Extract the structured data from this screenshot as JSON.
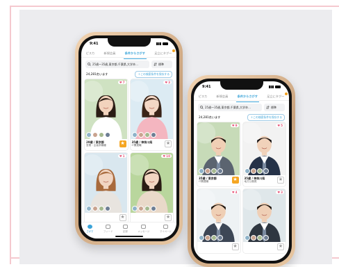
{
  "colors": {
    "accent": "#3aa3d8",
    "like": "#e8567a",
    "fav_on": "#f5a623",
    "panel_bg": "#ececef",
    "border": "#f5c9cf"
  },
  "phone_left": {
    "status": {
      "time": "9:41"
    },
    "tabs": [
      {
        "label": "ピスカ"
      },
      {
        "label": "新規会員"
      },
      {
        "label": "条件からさがす"
      },
      {
        "label": "足立にタグ〜"
      }
    ],
    "search": {
      "query": "25歳〜35歳,東京都,千葉県,大学卒…",
      "sort": "標準",
      "icon": "search-icon"
    },
    "count_text": "24,281名います",
    "add_condition_label": "＋この検索条件を保存する",
    "cards": [
      {
        "likes": "7",
        "age_place": "29歳 / 東京都",
        "job": "営業・企画系職種",
        "fav": true,
        "photo": "woman-blue-dress",
        "bg": "#cfe2c2",
        "skin": "#f2d3bd",
        "hair": "#2a1c14",
        "shirt": "#ffffff"
      },
      {
        "likes": "3",
        "age_place": "35歳 / 神奈川県",
        "job": "IT関連職",
        "fav": false,
        "photo": "woman-pink-top",
        "bg": "#dcebf3",
        "skin": "#f4d8c6",
        "hair": "#3a2418",
        "shirt": "#f4b6c0"
      },
      {
        "likes": "1",
        "age_place": "",
        "job": "",
        "fav": false,
        "photo": "woman-orange-hair",
        "bg": "#d9e7ef",
        "skin": "#f1d5c2",
        "hair": "#a86a3c",
        "shirt": "#e8e4df"
      },
      {
        "likes": "10",
        "age_place": "",
        "job": "",
        "fav": false,
        "photo": "woman-green-park",
        "bg": "#b9d69d",
        "skin": "#f2d5c1",
        "hair": "#2a1c14",
        "shirt": "#e9d9c9"
      }
    ],
    "nav": [
      {
        "label": "さがす",
        "icon": "search-nav-icon"
      },
      {
        "label": "フィード",
        "icon": "feed-icon"
      },
      {
        "label": "記録",
        "icon": "record-icon"
      },
      {
        "label": "メッセージ",
        "icon": "message-icon"
      },
      {
        "label": "マイページ",
        "icon": "mypage-icon"
      }
    ]
  },
  "phone_right": {
    "status": {
      "time": "9:41"
    },
    "tabs": [
      {
        "label": "ピスカ"
      },
      {
        "label": "新規会員"
      },
      {
        "label": "条件からさがす"
      },
      {
        "label": "足立にタグ〜"
      }
    ],
    "search": {
      "query": "25歳〜35歳,東京都,千葉県,大学卒…",
      "sort": "標準",
      "icon": "search-icon"
    },
    "count_text": "24,281名います",
    "add_condition_label": "＋この検索条件を保存する",
    "cards": [
      {
        "likes": "9",
        "age_place": "35歳 / 東京都",
        "job": "IT関連職",
        "fav": true,
        "photo": "man-gray-suit",
        "bg": "#c7dbb8",
        "skin": "#f0cfb5",
        "hair": "#1c140e",
        "shirt": "#5b6470"
      },
      {
        "likes": "5",
        "age_place": "35歳 / 神奈川県",
        "job": "地方公務員",
        "fav": false,
        "photo": "man-navy-suit",
        "bg": "#f2f2f2",
        "skin": "#f1d2ba",
        "hair": "#141010",
        "shirt": "#253248"
      },
      {
        "likes": "4",
        "age_place": "",
        "job": "",
        "fav": false,
        "photo": "man-glasses",
        "bg": "#eef2f4",
        "skin": "#efcfb5",
        "hair": "#1c140e",
        "shirt": "#3d4756"
      },
      {
        "likes": "3",
        "age_place": "",
        "job": "",
        "fav": false,
        "photo": "man-dark-suit",
        "bg": "#dfe7ea",
        "skin": "#efcfb6",
        "hair": "#1c140e",
        "shirt": "#2e3640"
      }
    ],
    "nav": []
  }
}
